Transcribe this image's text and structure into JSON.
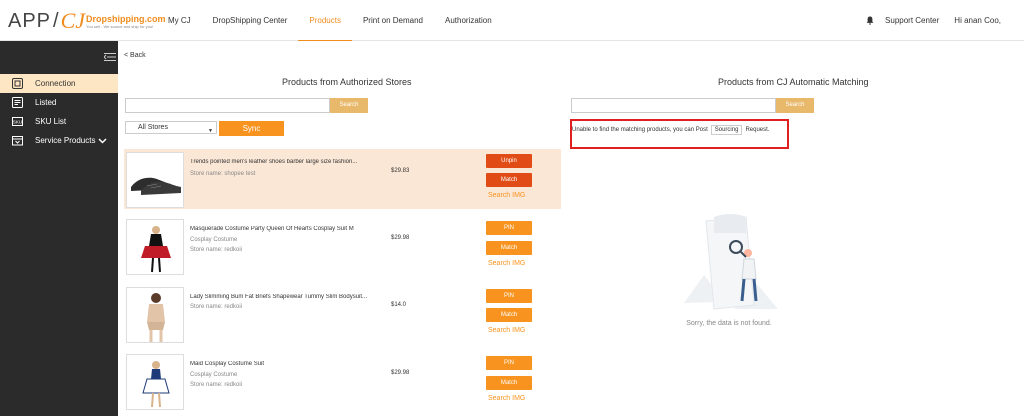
{
  "logo": {
    "app": "APP",
    "slash": "/",
    "cj": "CJ",
    "brand": "Dropshipping.com",
    "tagline": "You sell - We source and ship for you!"
  },
  "nav": {
    "items": [
      "My CJ",
      "DropShipping Center",
      "Products",
      "Print on Demand",
      "Authorization"
    ],
    "active": "Products"
  },
  "topright": {
    "support": "Support Center",
    "greeting": "Hi anan Coo,"
  },
  "sidebar": {
    "items": [
      {
        "label": "Connection",
        "icon": "connection-icon",
        "active": true
      },
      {
        "label": "Listed",
        "icon": "listed-icon"
      },
      {
        "label": "SKU List",
        "icon": "sku-icon"
      },
      {
        "label": "Service Products",
        "icon": "service-icon",
        "has_chevron": true
      }
    ]
  },
  "back": "< Back",
  "left": {
    "title": "Products from Authorized Stores",
    "search_label": "Search",
    "store_select": "All Stores",
    "sync_label": "Sync",
    "products": [
      {
        "name": "Trends pointed men's leather shoes barber large size fashion...",
        "sub": "",
        "store": "Store name: shopee test",
        "price": "$29.83",
        "btn1": "Unpin",
        "btn2": "Match",
        "search_img": "Search IMG"
      },
      {
        "name": "Masquerade Costume Party Queen Of Hearts Cosplay Suit M",
        "sub": "Cosplay Costume",
        "store": "Store name: redkoii",
        "price": "$29.98",
        "btn1": "PIN",
        "btn2": "Match",
        "search_img": "Search IMG"
      },
      {
        "name": "Lady Slimming Bum Fat Briefs Shapewear Tummy Slim Bodysuit...",
        "sub": "",
        "store": "Store name: redkoii",
        "price": "$14.0",
        "btn1": "PIN",
        "btn2": "Match",
        "search_img": "Search IMG"
      },
      {
        "name": "Maid Cosplay Costume Suit",
        "sub": "Cosplay Costume",
        "store": "Store name: redkoii",
        "price": "$29.98",
        "btn1": "PIN",
        "btn2": "Match",
        "search_img": "Search IMG"
      }
    ]
  },
  "right": {
    "title": "Products from CJ Automatic Matching",
    "search_label": "Search",
    "unable_prefix": "Unable to find the matching products, you can Post",
    "sourcing": "Sourcing",
    "unable_suffix": "Request.",
    "empty": "Sorry, the data is not found."
  }
}
